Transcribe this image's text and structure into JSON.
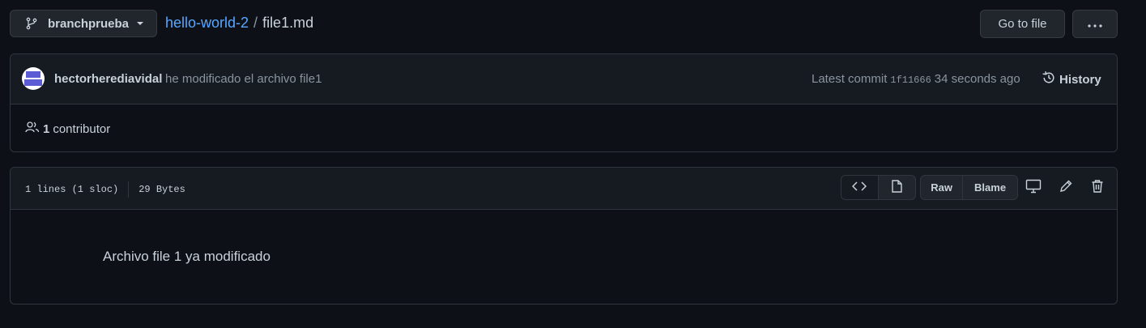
{
  "branch": {
    "name": "branchprueba"
  },
  "breadcrumb": {
    "repo": "hello-world-2",
    "separator": "/",
    "file": "file1.md"
  },
  "actions": {
    "goto_file": "Go to file",
    "more": "···"
  },
  "commit": {
    "author": "hectorherediavidal",
    "message": "he modificado el archivo file1",
    "latest_label": "Latest commit",
    "sha": "1f11666",
    "time": "34 seconds ago",
    "history_label": "History"
  },
  "contributors": {
    "count": "1",
    "label": "contributor"
  },
  "file": {
    "lines": "1 lines (1 sloc)",
    "size": "29 Bytes",
    "raw_label": "Raw",
    "blame_label": "Blame",
    "content": "Archivo file 1 ya modificado"
  },
  "colors": {
    "background": "#0d1117",
    "link": "#58a6ff",
    "muted": "#8b949e",
    "text": "#c9d1d9"
  }
}
